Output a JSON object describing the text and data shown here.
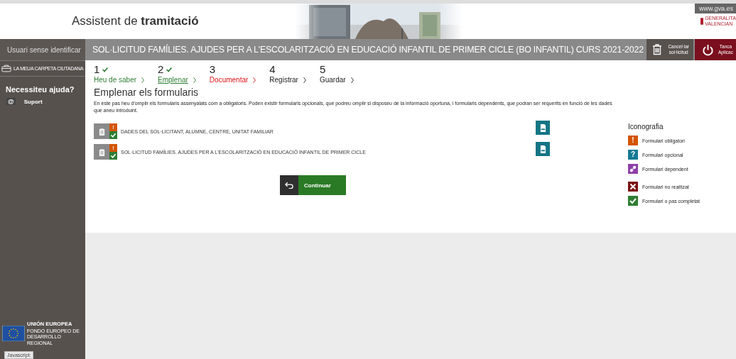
{
  "header": {
    "title_prefix": "Assistent de ",
    "title_bold": "tramitació",
    "site_link": "www.gva.es",
    "logo_lines": [
      "GENERALITA",
      "VALENCIAN"
    ]
  },
  "sidebar": {
    "user": "Usuari sense identificar",
    "folder_link": "LA MEUA CARPETA CIUTADANA",
    "help_title": "Necessiteu ajuda?",
    "support_icon": "@",
    "support_link": "Suport",
    "eu_title": "UNIÓN EUROPEA",
    "eu_subtitle": "FONDO EUROPEO DE DESARROLLO REGIONAL"
  },
  "title_bar": {
    "title": "SOL·LICITUD FAMÍLIES. AJUDES PER A L'ESCOLARITZACIÓ EN EDUCACIÓ INFANTIL DE PRIMER CICLE (BO INFANTIL) CURS 2021-2022",
    "cancel_button": [
      "Cancel·lar",
      "sol·licitud"
    ],
    "close_button": [
      "Tanca",
      "Aplicac"
    ]
  },
  "steps": [
    {
      "number": "1",
      "label": "Heu de saber",
      "completed": true,
      "selected": false,
      "kind": "done"
    },
    {
      "number": "2",
      "label": "Emplenar",
      "completed": true,
      "selected": true,
      "kind": "done"
    },
    {
      "number": "3",
      "label": "Documentar",
      "completed": false,
      "selected": false,
      "kind": "missing"
    },
    {
      "number": "4",
      "label": "Registrar",
      "completed": false,
      "selected": false,
      "kind": "pending"
    },
    {
      "number": "5",
      "label": "Guardar",
      "completed": false,
      "selected": false,
      "kind": "pending"
    }
  ],
  "section": {
    "heading": "Emplenar els formularis",
    "description": "En este pas heu d'omplir els formularis assenyalats com a obligatoris. Poden existir formularis opcionals, que podreu omplir si disposeu de la informació oportuna, i formularis dependents, que podran ser requerits en funció de les dades que aneu introduint."
  },
  "forms": [
    {
      "title": "DADES DEL SOL·LICITANT, ALUMNE, CENTRE, UNITAT FAMILIAR",
      "kind": "mandatory",
      "symbol": "!",
      "completed": true
    },
    {
      "title": "SOL·LICITUD FAMÍLIES. AJUDES PER A L'ESCOLARITZACIÓ EN EDUCACIÓ INFANTIL DE PRIMER CICLE",
      "kind": "mandatory",
      "symbol": "!",
      "completed": true
    }
  ],
  "continue_button": "Continuar",
  "legend": {
    "title": "Iconografia",
    "items": [
      {
        "kind": "mandatory",
        "symbol": "!",
        "label": "Formulari obligatori"
      },
      {
        "kind": "optional",
        "symbol": "?",
        "label": "Formulari opcional"
      },
      {
        "kind": "dependent",
        "label": "Formulari dependent"
      },
      {
        "kind": "not_done",
        "label": "Formulari no realitzat"
      },
      {
        "kind": "done",
        "label": "Formulari o pas completat"
      }
    ]
  },
  "status_text": "Javascript:"
}
